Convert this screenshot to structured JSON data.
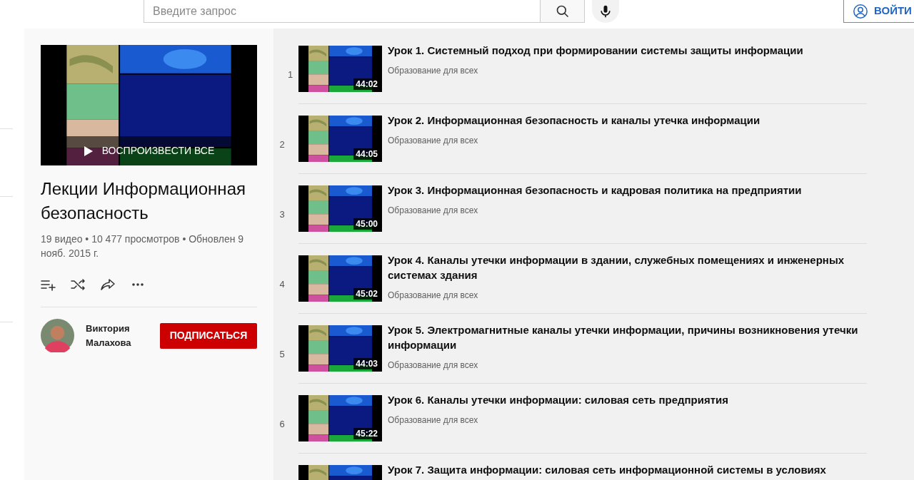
{
  "header": {
    "search": {
      "placeholder": "Введите запрос"
    },
    "login_button": "ВОЙТИ"
  },
  "playlist": {
    "play_all": "ВОСПРОИЗВЕСТИ ВСЕ",
    "title": "Лекции Информационная безопасность",
    "meta": "19 видео • 10 477 просмотров • Обновлен 9 нояб. 2015 г.",
    "owner": {
      "name": "Виктория Малахова"
    },
    "subscribe_button": "ПОДПИСАТЬСЯ"
  },
  "videos": [
    {
      "index": "1",
      "duration": "44:02",
      "title": "Урок 1. Системный подход при формировании системы защиты информации",
      "channel": "Образование для всех"
    },
    {
      "index": "2",
      "duration": "44:05",
      "title": "Урок 2. Информационная безопасность и каналы утечка информации",
      "channel": "Образование для всех"
    },
    {
      "index": "3",
      "duration": "45:00",
      "title": "Урок 3. Информационная безопасность и кадровая политика на предприятии",
      "channel": "Образование для всех"
    },
    {
      "index": "4",
      "duration": "45:02",
      "title": "Урок 4. Каналы утечки информации в здании, служебных помещениях и инженерных системах здания",
      "channel": "Образование для всех"
    },
    {
      "index": "5",
      "duration": "44:03",
      "title": "Урок 5. Электромагнитные каналы утечки информации, причины возникновения утечки информации",
      "channel": "Образование для всех"
    },
    {
      "index": "6",
      "duration": "45:22",
      "title": "Урок 6. Каналы утечки информации: силовая сеть предприятия",
      "channel": "Образование для всех"
    },
    {
      "title": "Урок 7. Защита информации: силовая сеть информационной системы в условиях"
    }
  ]
}
